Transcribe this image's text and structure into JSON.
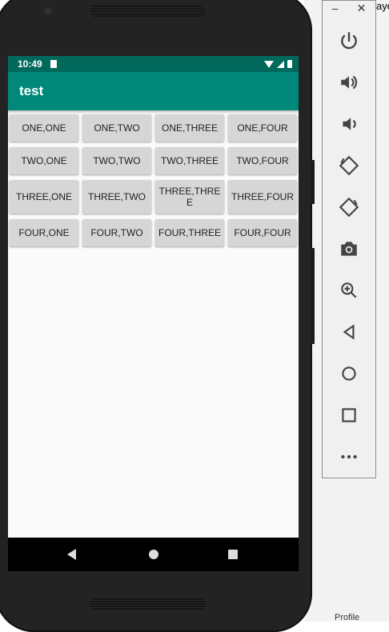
{
  "status_bar": {
    "time": "10:49"
  },
  "app_bar": {
    "title": "test"
  },
  "grid": [
    [
      "ONE,ONE",
      "ONE,TWO",
      "ONE,THREE",
      "ONE,FOUR"
    ],
    [
      "TWO,ONE",
      "TWO,TWO",
      "TWO,THREE",
      "TWO,FOUR"
    ],
    [
      "THREE,ONE",
      "THREE,TWO",
      "THREE,THREE",
      "THREE,FOUR"
    ],
    [
      "FOUR,ONE",
      "FOUR,TWO",
      "FOUR,THREE",
      "FOUR,FOUR"
    ]
  ],
  "window_controls": {
    "minimize": "–",
    "close": "✕"
  },
  "desktop": {
    "edge_text": "ayo",
    "bottom_text": "Profile"
  },
  "emulator_toolbar": {
    "icons": [
      "power-icon",
      "volume-up-icon",
      "volume-down-icon",
      "rotate-left-icon",
      "rotate-right-icon",
      "camera-icon",
      "zoom-icon",
      "back-icon",
      "home-icon",
      "overview-icon",
      "more-icon"
    ]
  }
}
